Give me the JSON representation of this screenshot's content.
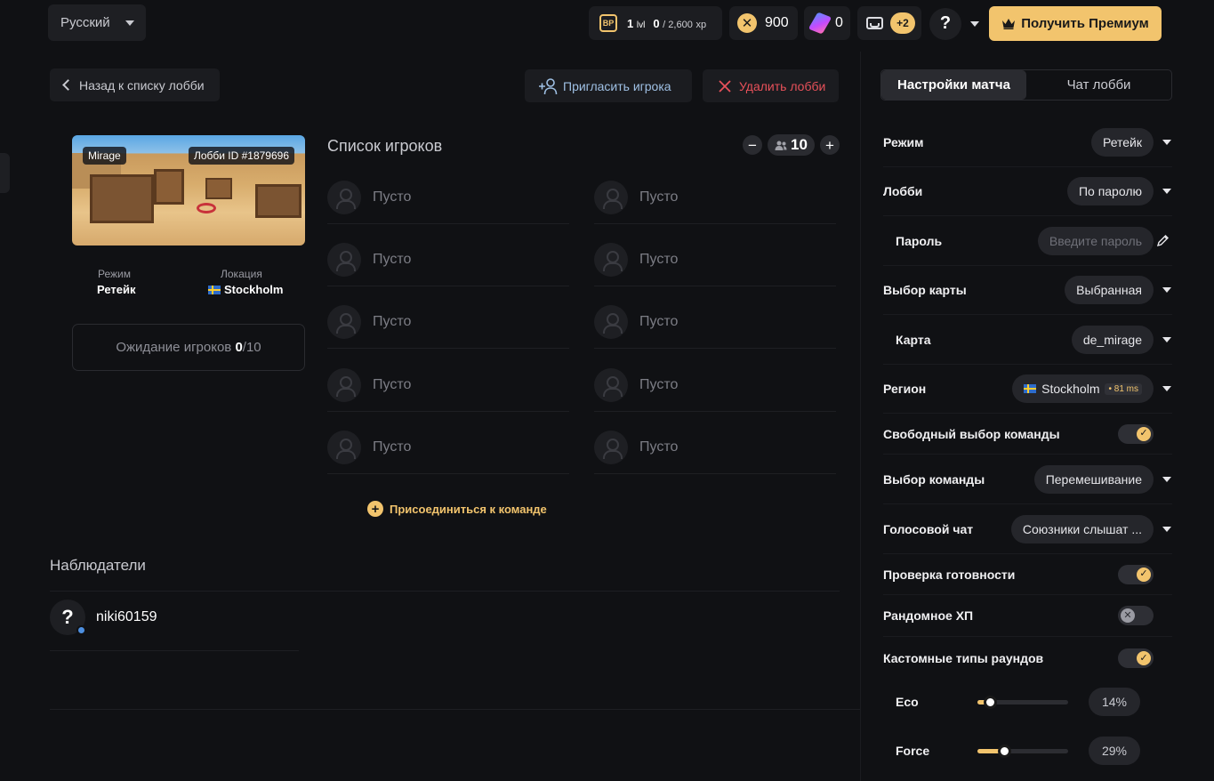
{
  "topbar": {
    "language": "Русский",
    "battlepass": {
      "badge": "BP",
      "level": "1",
      "level_unit": "lvl",
      "xp": "0",
      "xp_total": "/ 2,600",
      "xp_unit": "xp"
    },
    "coins": "900",
    "gems": "0",
    "inbox_badge": "+2",
    "help": "?",
    "premium_label": "Получить Премиум"
  },
  "lobby": {
    "back_label": "Назад к списку лобби",
    "invite_label": "Пригласить игрока",
    "delete_label": "Удалить лобби",
    "map_name": "Mirage",
    "lobby_id": "Лобби ID #1879696",
    "mode_label": "Режим",
    "mode_value": "Ретейк",
    "location_label": "Локация",
    "location_value": "Stockholm",
    "waiting_text": "Ожидание игроков",
    "waiting_current": "0",
    "waiting_total": "/10"
  },
  "players": {
    "title": "Список игроков",
    "minus": "−",
    "count": "10",
    "plus": "+",
    "left": [
      "Пусто",
      "Пусто",
      "Пусто",
      "Пусто",
      "Пусто"
    ],
    "right": [
      "Пусто",
      "Пусто",
      "Пусто",
      "Пусто",
      "Пусто"
    ],
    "join_label": "Присоединиться к команде"
  },
  "spectators": {
    "title": "Наблюдатели",
    "items": [
      {
        "avatar": "?",
        "name": "niki60159"
      }
    ]
  },
  "settings": {
    "tabs": [
      "Настройки матча",
      "Чат лобби"
    ],
    "rows": {
      "mode": {
        "label": "Режим",
        "value": "Ретейк"
      },
      "lobby": {
        "label": "Лобби",
        "value": "По паролю"
      },
      "password": {
        "label": "Пароль",
        "placeholder": "Введите пароль"
      },
      "map_select": {
        "label": "Выбор карты",
        "value": "Выбранная"
      },
      "map": {
        "label": "Карта",
        "value": "de_mirage"
      },
      "region": {
        "label": "Регион",
        "value": "Stockholm",
        "ping": "81 ms"
      },
      "free_team": {
        "label": "Свободный выбор команды",
        "enabled": true
      },
      "team_select": {
        "label": "Выбор команды",
        "value": "Перемешивание"
      },
      "voice": {
        "label": "Голосовой чат",
        "value": "Союзники слышат ..."
      },
      "ready_check": {
        "label": "Проверка готовности",
        "enabled": true
      },
      "random_hp": {
        "label": "Рандомное ХП",
        "enabled": false
      },
      "custom_rounds": {
        "label": "Кастомные типы раундов",
        "enabled": true
      }
    },
    "sliders": [
      {
        "label": "Eco",
        "value": 14,
        "display": "14%"
      },
      {
        "label": "Force",
        "value": 29,
        "display": "29%"
      }
    ]
  },
  "colors": {
    "accent": "#f2c46d",
    "danger": "#e8515a",
    "link": "#9fc0e4",
    "background": "#101114"
  },
  "icons": [
    "battlepass-icon",
    "coin-icon",
    "gem-icon",
    "inbox-icon",
    "crown-icon",
    "user-plus-icon",
    "close-icon",
    "pencil-icon",
    "sweden-flag-icon"
  ]
}
